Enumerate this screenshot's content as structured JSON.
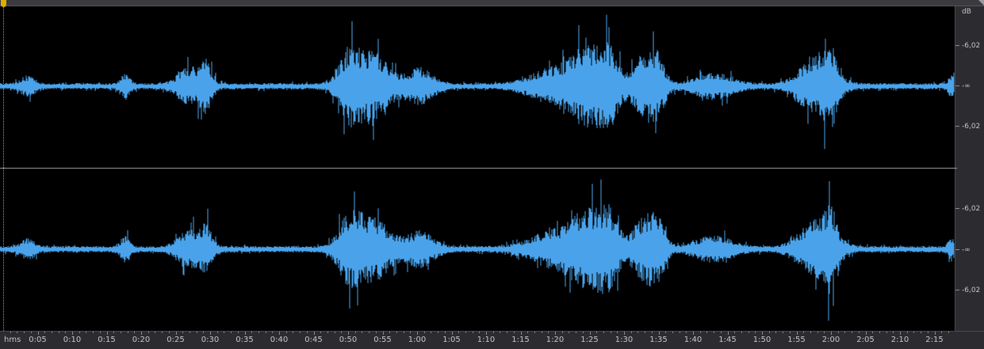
{
  "waveform": {
    "channels": 2,
    "color": "#4aa3ea",
    "background": "#000000",
    "playhead_color": "#d9b000"
  },
  "db_ruler": {
    "unit": "dB",
    "channel_1_labels": [
      "-6,02",
      "-∞",
      "-6,02"
    ],
    "channel_2_labels": [
      "-6,02",
      "-∞",
      "-6,02"
    ]
  },
  "time_ruler": {
    "unit": "hms",
    "labels": [
      "0:05",
      "0:10",
      "0:15",
      "0:20",
      "0:25",
      "0:30",
      "0:35",
      "0:40",
      "0:45",
      "0:50",
      "0:55",
      "1:00",
      "1:05",
      "1:10",
      "1:15",
      "1:20",
      "1:25",
      "1:30",
      "1:35",
      "1:40",
      "1:45",
      "1:50",
      "1:55",
      "2:00",
      "2:05",
      "2:10",
      "2:15"
    ]
  }
}
